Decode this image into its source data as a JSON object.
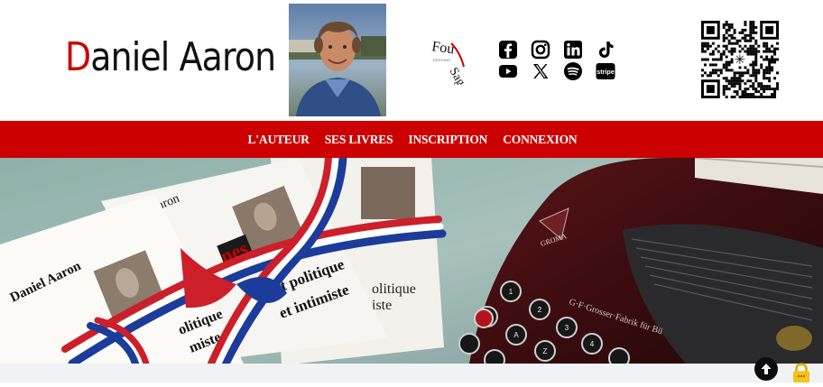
{
  "header": {
    "title_initial": "D",
    "title_rest": "aniel Aaron",
    "publisher_logo": {
      "name": "fou-sage-logo",
      "text_top": "Fou",
      "text_bottom": "Sage"
    },
    "social_icons": [
      "facebook-icon",
      "instagram-icon",
      "linkedin-icon",
      "tiktok-icon",
      "youtube-icon",
      "x-icon",
      "spotify-icon",
      "stripe-icon"
    ],
    "stripe_label": "stripe",
    "qr_code": "qr-code"
  },
  "nav": {
    "items": [
      {
        "label": "L'AUTEUR"
      },
      {
        "label": "SES LIVRES"
      },
      {
        "label": "INSCRIPTION"
      },
      {
        "label": "CONNEXION"
      }
    ]
  },
  "hero": {
    "book_author": "Daniel Aaron",
    "book_title_line1": "rnet politique",
    "book_title_line2": "et intimiste",
    "book_title_left1": "olitique",
    "book_title_left2": "miste",
    "book_title_right1": "olitique",
    "book_title_right2": "iste",
    "typewriter_brand": "GROMA",
    "typewriter_maker": "G·F·Grosser·Fabrik für Bü"
  },
  "colors": {
    "brand_red": "#cc0000",
    "title_black": "#111111",
    "footer_bg": "#f0f2f4"
  }
}
